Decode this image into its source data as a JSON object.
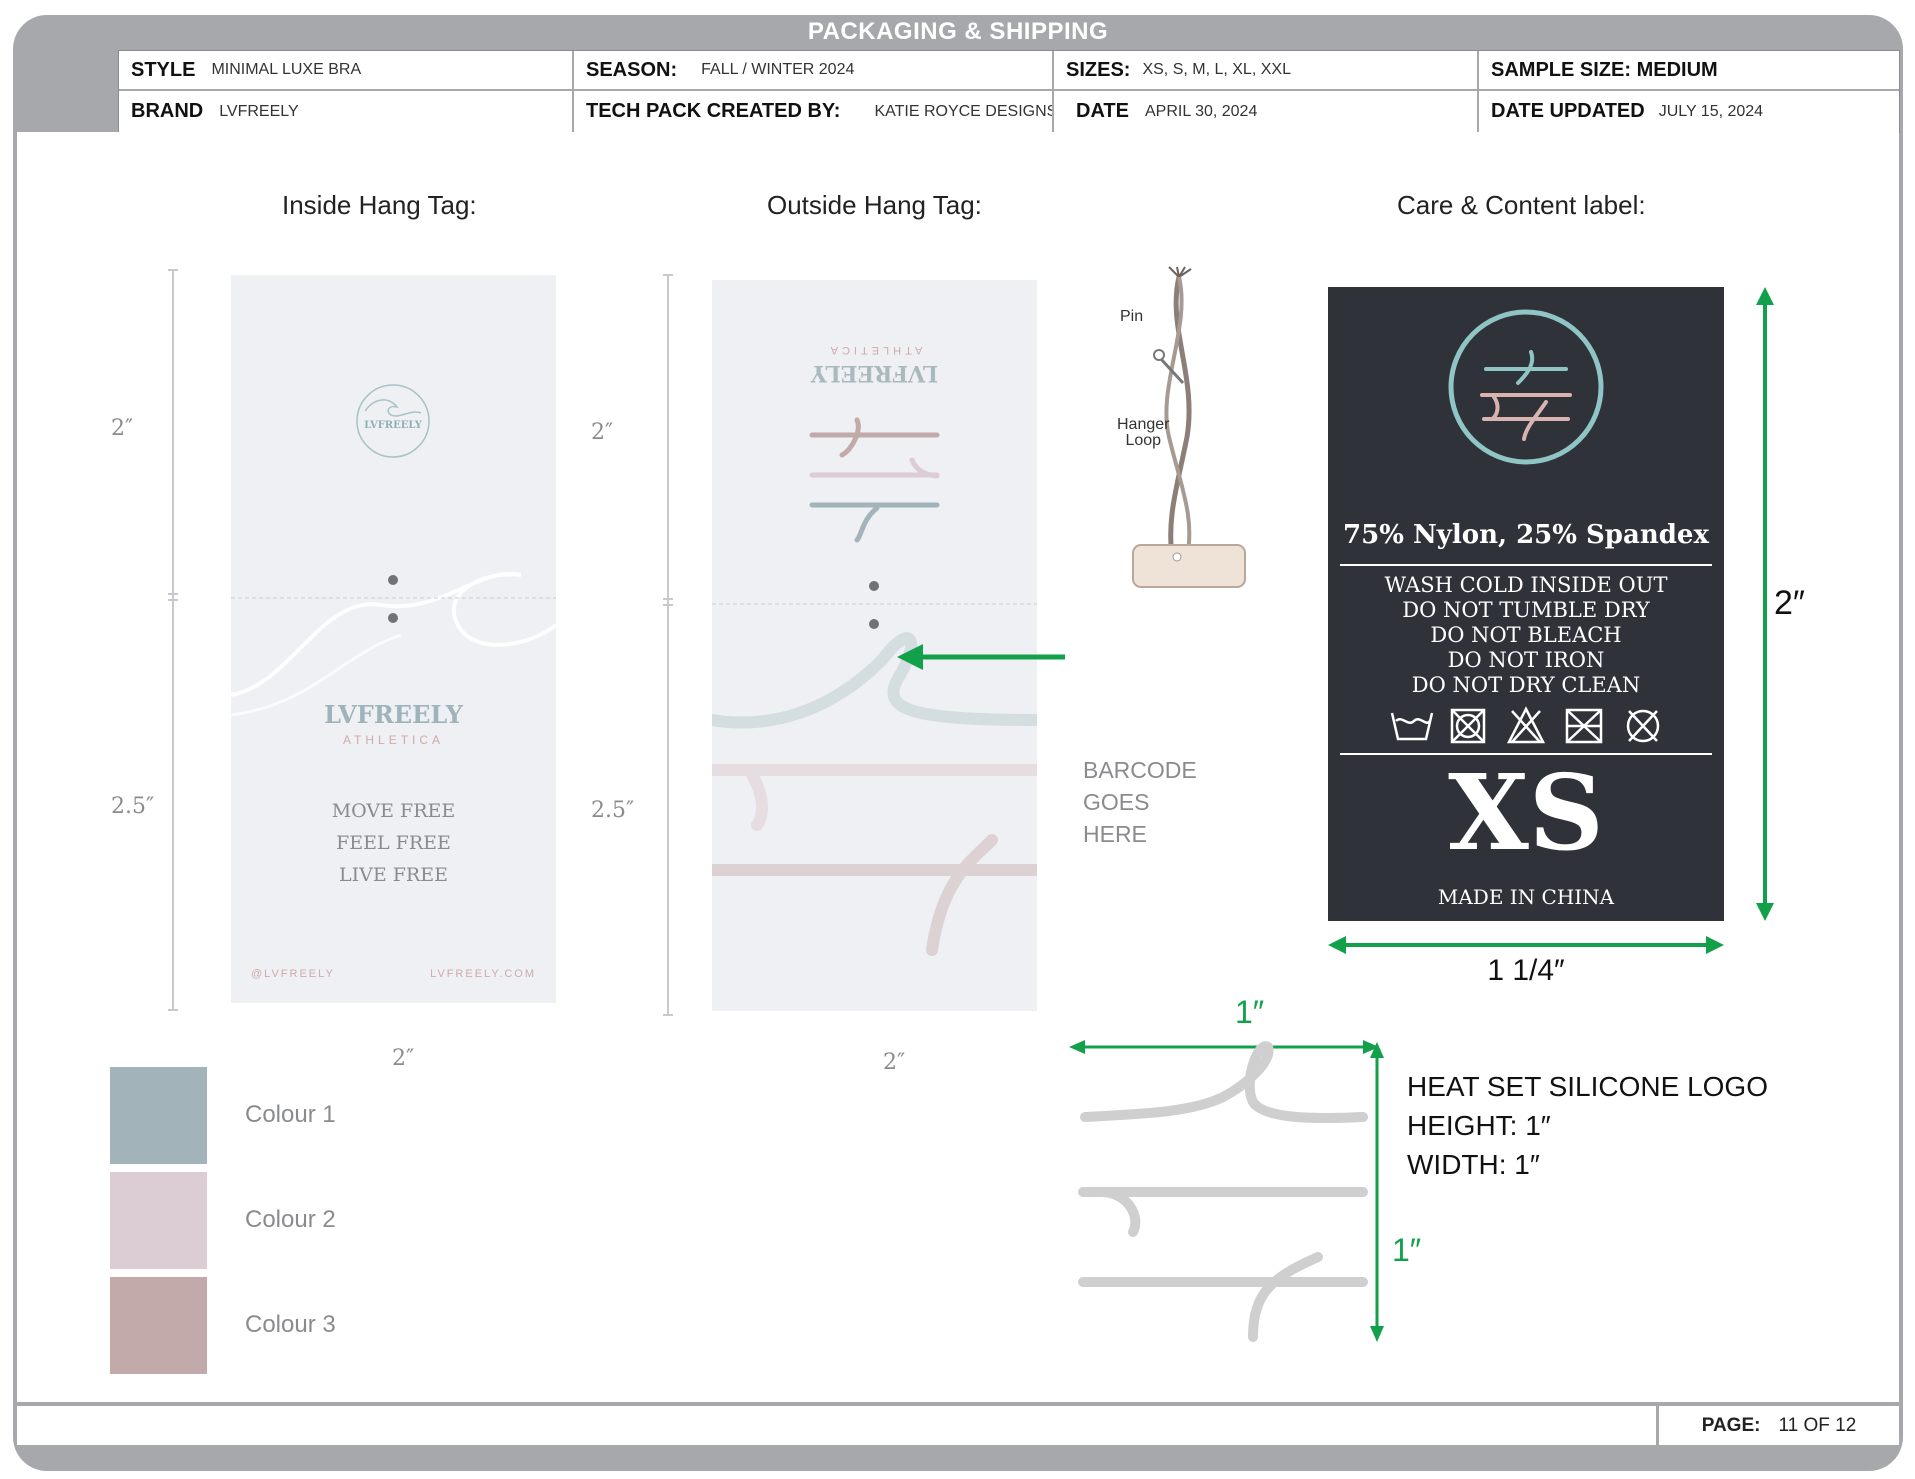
{
  "header": {
    "title": "PACKAGING & SHIPPING",
    "style_label": "STYLE",
    "style_value": "MINIMAL LUXE BRA",
    "season_label": "SEASON:",
    "season_value": "FALL / WINTER 2024",
    "sizes_label": "SIZES:",
    "sizes_value": "XS, S, M, L, XL, XXL",
    "sample_label": "SAMPLE SIZE: MEDIUM",
    "brand_label": "BRAND",
    "brand_value": "LVFREELY",
    "techpack_label": "TECH PACK CREATED BY:",
    "techpack_value": "KATIE ROYCE DESIGNS",
    "date_label": "DATE",
    "date_value": "APRIL 30, 2024",
    "updated_label": "DATE UPDATED",
    "updated_value": "JULY 15, 2024"
  },
  "inside_tag": {
    "title": "Inside Hang Tag:",
    "dim_top": "2″",
    "dim_bottom": "2.5″",
    "dim_width": "2″",
    "logo_text": "LVFREELY",
    "brand": "LVFREELY",
    "subbrand": "ATHLETICA",
    "lines": [
      "MOVE FREE",
      "FEEL FREE",
      "LIVE FREE"
    ],
    "social": "@LVFREELY",
    "website": "LVFREELY.COM"
  },
  "outside_tag": {
    "title": "Outside Hang Tag:",
    "dim_top": "2″",
    "dim_bottom": "2.5″",
    "dim_width": "2″",
    "brand": "LVFREELY",
    "subbrand": "ATHLETICA",
    "barcode_note": [
      "BARCODE",
      "GOES",
      "HERE"
    ]
  },
  "hanger": {
    "pin_label": "Pin",
    "loop_label": [
      "Hanger",
      "Loop"
    ]
  },
  "care_label": {
    "title": "Care & Content label:",
    "content": "75% Nylon, 25% Spandex",
    "instructions": [
      "WASH COLD INSIDE OUT",
      "DO NOT TUMBLE DRY",
      "DO NOT BLEACH",
      "DO NOT IRON",
      "DO NOT DRY CLEAN"
    ],
    "size": "XS",
    "origin": "MADE IN CHINA",
    "dim_height": "2″",
    "dim_width": "1 1/4″"
  },
  "silicone_logo": {
    "dim_width": "1″",
    "dim_height": "1″",
    "lines": [
      "HEAT SET SILICONE LOGO",
      "HEIGHT: 1″",
      "WIDTH: 1″"
    ]
  },
  "colours": [
    {
      "label": "Colour 1",
      "hex": "#a3b3ba"
    },
    {
      "label": "Colour 2",
      "hex": "#dccdd4"
    },
    {
      "label": "Colour 3",
      "hex": "#c2a9aa"
    }
  ],
  "footer": {
    "page_label": "PAGE:",
    "page_value": "11 OF 12"
  }
}
